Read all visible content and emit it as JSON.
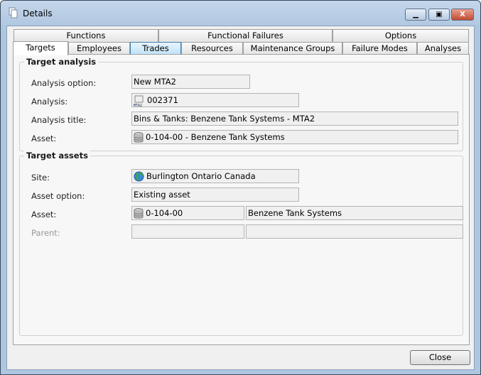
{
  "window": {
    "title": "Details",
    "minimize": "▁",
    "maximize": "▣",
    "close": "X"
  },
  "tabs_row1": [
    {
      "label": "Functions"
    },
    {
      "label": "Functional Failures"
    },
    {
      "label": "Options"
    }
  ],
  "tabs_row2": [
    {
      "label": "Targets",
      "selected": true
    },
    {
      "label": "Employees"
    },
    {
      "label": "Trades"
    },
    {
      "label": "Resources"
    },
    {
      "label": "Maintenance Groups"
    },
    {
      "label": "Failure Modes"
    },
    {
      "label": "Analyses"
    }
  ],
  "target_analysis": {
    "legend": "Target analysis",
    "analysis_option_label": "Analysis option:",
    "analysis_option": "New MTA2",
    "analysis_label": "Analysis:",
    "analysis": "002371",
    "analysis_icon_text": "MTA2",
    "analysis_title_label": "Analysis title:",
    "analysis_title": "Bins & Tanks: Benzene Tank Systems - MTA2",
    "asset_label": "Asset:",
    "asset": "0-104-00 - Benzene Tank Systems"
  },
  "target_assets": {
    "legend": "Target assets",
    "site_label": "Site:",
    "site": "Burlington Ontario Canada",
    "asset_option_label": "Asset option:",
    "asset_option": "Existing asset",
    "asset_label": "Asset:",
    "asset_code": "0-104-00",
    "asset_name": "Benzene Tank Systems",
    "parent_label": "Parent:",
    "parent_code": "",
    "parent_name": ""
  },
  "footer": {
    "close_label": "Close"
  }
}
